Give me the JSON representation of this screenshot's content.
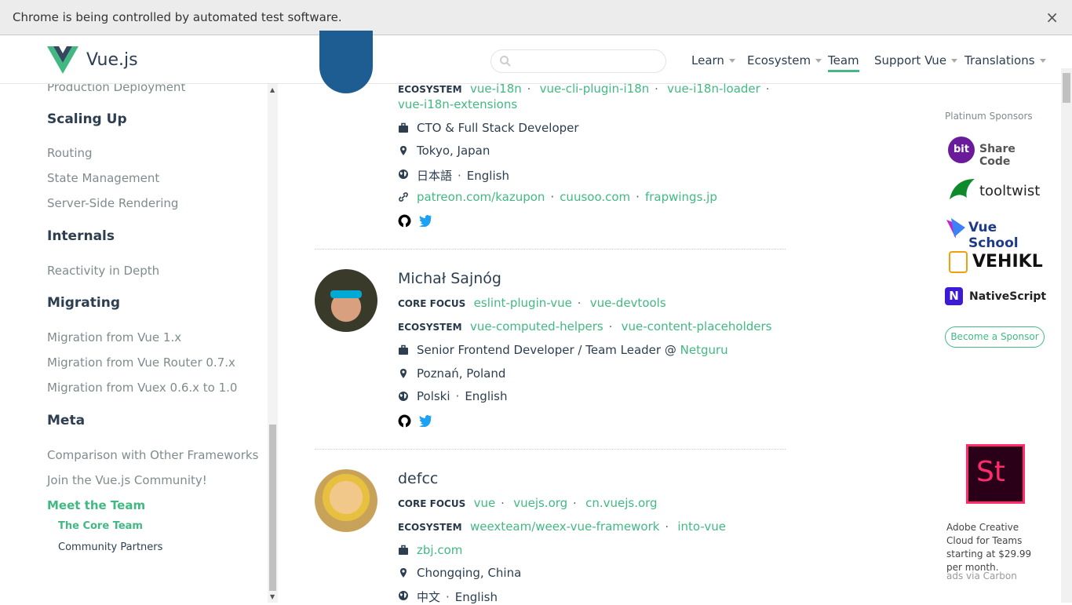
{
  "infobar": {
    "text": "Chrome is being controlled by automated test software.",
    "close": "×"
  },
  "header": {
    "logo_text": "Vue.js",
    "search_placeholder": "",
    "nav": [
      {
        "label": "Learn",
        "dropdown": true
      },
      {
        "label": "Ecosystem",
        "dropdown": true
      },
      {
        "label": "Team",
        "dropdown": false,
        "active": true
      },
      {
        "label": "Support Vue",
        "dropdown": true
      },
      {
        "label": "Translations",
        "dropdown": true
      }
    ]
  },
  "sidebar": {
    "top_item": "Production Deployment",
    "sections": [
      {
        "title": "Scaling Up",
        "items": [
          "Routing",
          "State Management",
          "Server-Side Rendering"
        ]
      },
      {
        "title": "Internals",
        "items": [
          "Reactivity in Depth"
        ]
      },
      {
        "title": "Migrating",
        "items": [
          "Migration from Vue 1.x",
          "Migration from Vue Router 0.7.x",
          "Migration from Vuex 0.6.x to 1.0"
        ]
      },
      {
        "title": "Meta",
        "items": [
          "Comparison with Other Frameworks",
          "Join the Vue.js Community!",
          "Meet the Team"
        ]
      }
    ],
    "sub_items": [
      "The Core Team",
      "Community Partners"
    ]
  },
  "members": [
    {
      "name": "",
      "ecosystem_label": "ECOSYSTEM",
      "ecosystem": [
        "vue-i18n",
        "vue-cli-plugin-i18n",
        "vue-i18n-loader",
        "vue-i18n-extensions"
      ],
      "work": "CTO & Full Stack Developer",
      "location": "Tokyo, Japan",
      "languages": [
        "日本語",
        "English"
      ],
      "links": [
        "patreon.com/kazupon",
        "cuusoo.com",
        "frapwings.jp"
      ]
    },
    {
      "name": "Michał Sajnóg",
      "core_label": "CORE FOCUS",
      "core": [
        "eslint-plugin-vue",
        "vue-devtools"
      ],
      "ecosystem_label": "ECOSYSTEM",
      "ecosystem": [
        "vue-computed-helpers",
        "vue-content-placeholders"
      ],
      "work": "Senior Frontend Developer / Team Leader @ ",
      "work_link": "Netguru",
      "location": "Poznań, Poland",
      "languages": [
        "Polski",
        "English"
      ]
    },
    {
      "name": "defcc",
      "core_label": "CORE FOCUS",
      "core": [
        "vue",
        "vuejs.org",
        "cn.vuejs.org"
      ],
      "ecosystem_label": "ECOSYSTEM",
      "ecosystem": [
        "weexteam/weex-vue-framework",
        "into-vue"
      ],
      "work_link": "zbj.com",
      "location": "Chongqing, China",
      "languages": [
        "中文",
        "English"
      ]
    }
  ],
  "right": {
    "sponsor_title": "Platinum Sponsors",
    "sponsors": [
      "Share Code",
      "tooltwist",
      "Vue School",
      "VEHIKL",
      "NativeScript"
    ],
    "bit_label": "bit",
    "become": "Become a Sponsor",
    "ad_logo": "St",
    "ad_text": "Adobe Creative Cloud for Teams starting at $29.99 per month.",
    "ad_via": "ads via Carbon"
  },
  "colors": {
    "accent": "#42b983",
    "text": "#2c3e50",
    "muted": "#7f8c8d"
  }
}
